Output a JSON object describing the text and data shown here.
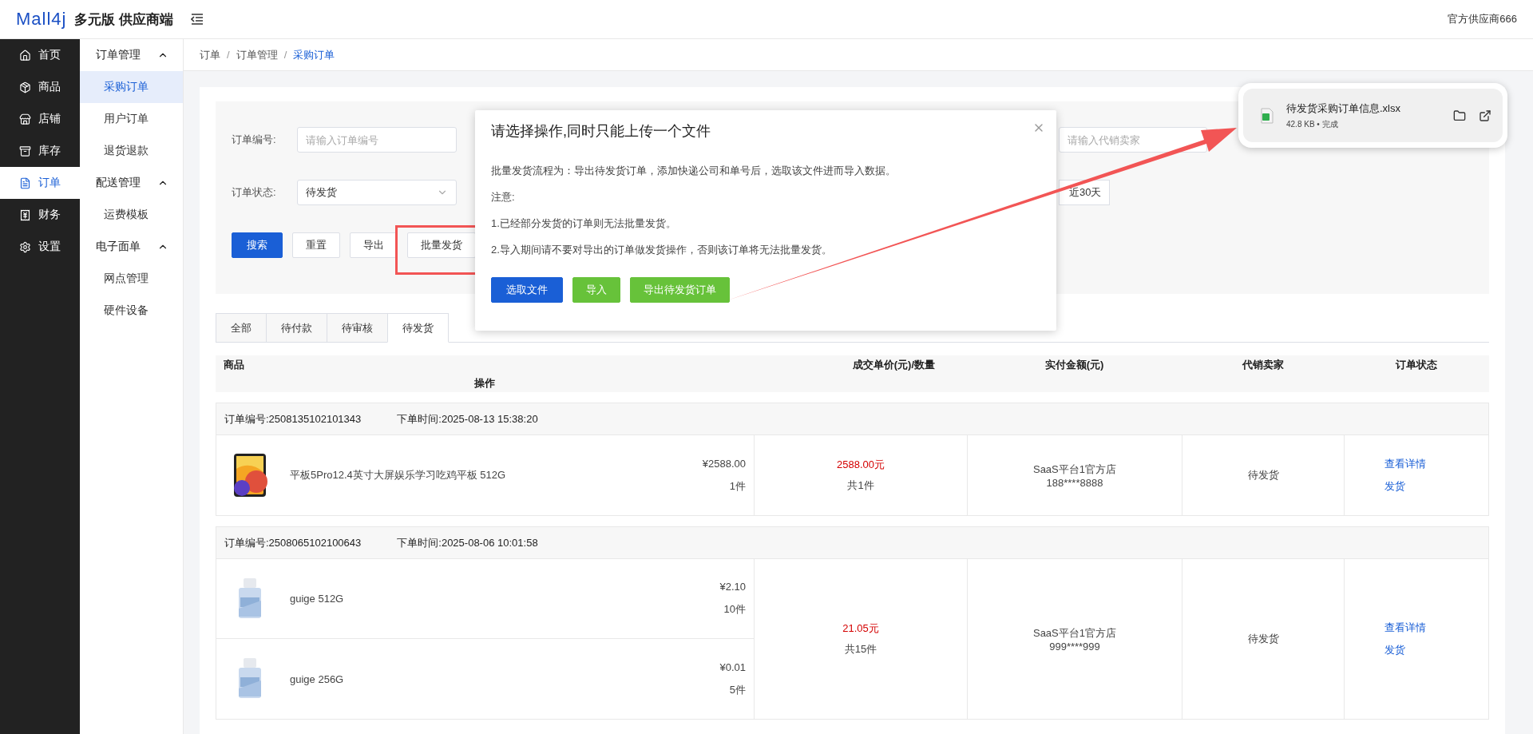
{
  "header": {
    "logo": "Mall4j",
    "title": "多元版 供应商端",
    "user": "官方供应商666"
  },
  "nav": [
    {
      "label": "首页",
      "selected": false
    },
    {
      "label": "商品",
      "selected": false
    },
    {
      "label": "店铺",
      "selected": false
    },
    {
      "label": "库存",
      "selected": false
    },
    {
      "label": "订单",
      "selected": true
    },
    {
      "label": "财务",
      "selected": false
    },
    {
      "label": "设置",
      "selected": false
    }
  ],
  "subnav": [
    {
      "label": "订单管理",
      "expanded": true,
      "children": [
        {
          "label": "采购订单",
          "selected": true
        },
        {
          "label": "用户订单",
          "selected": false
        },
        {
          "label": "退货退款",
          "selected": false
        }
      ]
    },
    {
      "label": "配送管理",
      "expanded": true,
      "children": [
        {
          "label": "运费模板",
          "selected": false
        }
      ]
    },
    {
      "label": "电子面单",
      "expanded": true,
      "children": [
        {
          "label": "网点管理",
          "selected": false
        },
        {
          "label": "硬件设备",
          "selected": false
        }
      ]
    }
  ],
  "breadcrumb_separator": "/",
  "breadcrumb": [
    {
      "label": "订单",
      "selected": false
    },
    {
      "label": "订单管理",
      "selected": false
    },
    {
      "label": "采购订单",
      "selected": true
    }
  ],
  "filters": {
    "order_no": {
      "label": "订单编号:",
      "placeholder": "请输入订单编号"
    },
    "seller": {
      "placeholder": "请输入代销卖家"
    },
    "status": {
      "label": "订单状态:",
      "value": "待发货"
    },
    "range_button": "近30天"
  },
  "actions": [
    {
      "label": "搜索",
      "kind": "primary"
    },
    {
      "label": "重置",
      "kind": "default"
    },
    {
      "label": "导出",
      "kind": "default"
    },
    {
      "label": "批量发货",
      "kind": "default"
    }
  ],
  "tabs": [
    {
      "label": "全部",
      "selected": false
    },
    {
      "label": "待付款",
      "selected": false
    },
    {
      "label": "待审核",
      "selected": false
    },
    {
      "label": "待发货",
      "selected": true
    }
  ],
  "table": {
    "columns": [
      "商品",
      "成交单价(元)/数量",
      "实付金额(元)",
      "代销卖家",
      "订单状态",
      "操作"
    ],
    "orders": [
      {
        "order_no": "订单编号:2508135102101343",
        "time": "下单时间:2025-08-13 15:38:20",
        "items": [
          {
            "name": "平板5Pro12.4英寸大屏娱乐学习吃鸡平板 512G",
            "price": "¥2588.00",
            "qty": "1件"
          }
        ],
        "total": "2588.00元",
        "count": "共1件",
        "seller": "SaaS平台1官方店",
        "phone": "188****8888",
        "status": "待发货",
        "links": [
          "查看详情",
          "发货"
        ]
      },
      {
        "order_no": "订单编号:2508065102100643",
        "time": "下单时间:2025-08-06 10:01:58",
        "items": [
          {
            "name": "guige 512G",
            "price": "¥2.10",
            "qty": "10件"
          },
          {
            "name": "guige 256G",
            "price": "¥0.01",
            "qty": "5件"
          }
        ],
        "total": "21.05元",
        "count": "共15件",
        "seller": "SaaS平台1官方店",
        "phone": "999****999",
        "status": "待发货",
        "links": [
          "查看详情",
          "发货"
        ]
      }
    ]
  },
  "dialog": {
    "title": "请选择操作,同时只能上传一个文件",
    "text": "批量发货流程为：导出待发货订单，添加快递公司和单号后，选取该文件进而导入数据。",
    "note_label": "注意:",
    "notes": [
      "1.已经部分发货的订单则无法批量发货。",
      "2.导入期间请不要对导出的订单做发货操作，否则该订单将无法批量发货。"
    ],
    "buttons": [
      {
        "label": "选取文件",
        "kind": "primary"
      },
      {
        "label": "导入",
        "kind": "success"
      },
      {
        "label": "导出待发货订单",
        "kind": "success"
      }
    ]
  },
  "download": {
    "filename": "待发货采购订单信息.xlsx",
    "meta": "42.8 KB • 完成"
  }
}
